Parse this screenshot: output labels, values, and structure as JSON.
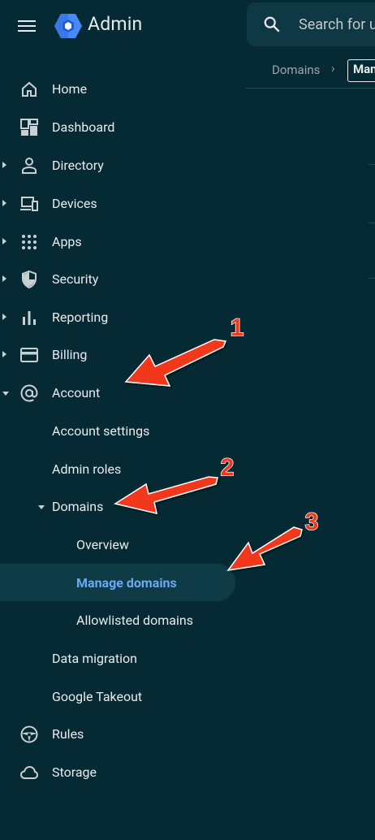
{
  "header": {
    "app_title": "Admin",
    "search_placeholder": "Search for u",
    "logo_color": "#4285f4"
  },
  "breadcrumb": {
    "parent": "Domains",
    "separator": "›",
    "current": "Manage domains"
  },
  "sidebar": {
    "items": [
      {
        "label": "Home",
        "icon": "home-icon"
      },
      {
        "label": "Dashboard",
        "icon": "dashboard-icon"
      },
      {
        "label": "Directory",
        "icon": "person-icon"
      },
      {
        "label": "Devices",
        "icon": "devices-icon"
      },
      {
        "label": "Apps",
        "icon": "apps-grid-icon"
      },
      {
        "label": "Security",
        "icon": "shield-icon"
      },
      {
        "label": "Reporting",
        "icon": "bar-chart-icon"
      },
      {
        "label": "Billing",
        "icon": "credit-card-icon"
      },
      {
        "label": "Account",
        "icon": "at-sign-icon"
      },
      {
        "label": "Account settings"
      },
      {
        "label": "Admin roles"
      },
      {
        "label": "Domains"
      },
      {
        "label": "Overview"
      },
      {
        "label": "Manage domains"
      },
      {
        "label": "Allowlisted domains"
      },
      {
        "label": "Data migration"
      },
      {
        "label": "Google Takeout"
      },
      {
        "label": "Rules",
        "icon": "steering-wheel-icon"
      },
      {
        "label": "Storage",
        "icon": "cloud-icon"
      }
    ],
    "active_color": "#6aa9f0"
  },
  "annotations": [
    {
      "number": "1"
    },
    {
      "number": "2"
    },
    {
      "number": "3"
    }
  ],
  "annotation_color": "#f2371c"
}
